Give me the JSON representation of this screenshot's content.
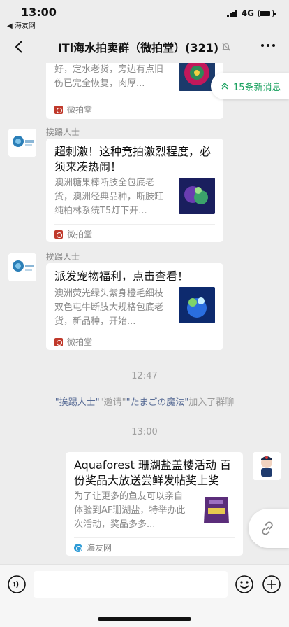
{
  "status_bar": {
    "time": "13:00",
    "back_app": "◀ 海友网",
    "network": "4G",
    "battery_level": 0.85
  },
  "nav": {
    "title": "ITi海水拍卖群（微拍堂）(321)",
    "mute_icon": "bell-mute-icon",
    "more_icon": "more-dots-icon"
  },
  "new_messages": {
    "label": "15条新消息",
    "icon": "double-chevron-up-icon"
  },
  "messages": [
    {
      "type": "card",
      "sender": "",
      "title": "",
      "desc": "好，定水老货，旁边有点旧伤已完全恢复，肉厚...",
      "source": "微拍堂",
      "thumb_colors": [
        "#1b3a6b",
        "#2e8b57",
        "#c2185b"
      ]
    },
    {
      "type": "card",
      "sender": "挨踢人士",
      "title": "超刺激！这种竞拍激烈程度，必须来凑热闹！",
      "desc": "澳洲糖果棒断肢全包底老货，澳洲经典品种，断肢缸纯柏林系统T5灯下开...",
      "source": "微拍堂",
      "thumb_colors": [
        "#1a1f5e",
        "#3ba36b",
        "#6a3db0"
      ]
    },
    {
      "type": "card",
      "sender": "挨踢人士",
      "title": "派发宠物福利，点击查看！",
      "desc": "澳洲荧光绿头紫身橙毛细枝双色屯牛断肢大规格包底老货，新品种，开始...",
      "source": "微拍堂",
      "thumb_colors": [
        "#0d2a6e",
        "#2a6ee0",
        "#7fd36a"
      ]
    },
    {
      "type": "time",
      "text": "12:47"
    },
    {
      "type": "system",
      "inviter": "\"挨踢人士\"",
      "verb": "\"邀请\"",
      "invitee": "\"たまごの魔法\"",
      "suffix": "加入了群聊"
    },
    {
      "type": "time",
      "text": "13:00"
    },
    {
      "type": "card",
      "sender": "",
      "title": "Aquaforest 珊湖盐盖楼活动 百份奖品大放送尝鲜发帖奖上奖",
      "desc": "为了让更多的鱼友可以亲自体验到AF珊湖盐，特举办此次活动，奖品多多...",
      "source": "海友网",
      "thumb_colors": [
        "#ffffff",
        "#5b2d7a",
        "#e6c94f"
      ]
    }
  ],
  "input_bar": {
    "placeholder": "",
    "voice_icon": "voice-icon",
    "emoji_icon": "emoji-icon",
    "plus_icon": "plus-icon"
  },
  "float_button_icon": "link-icon"
}
